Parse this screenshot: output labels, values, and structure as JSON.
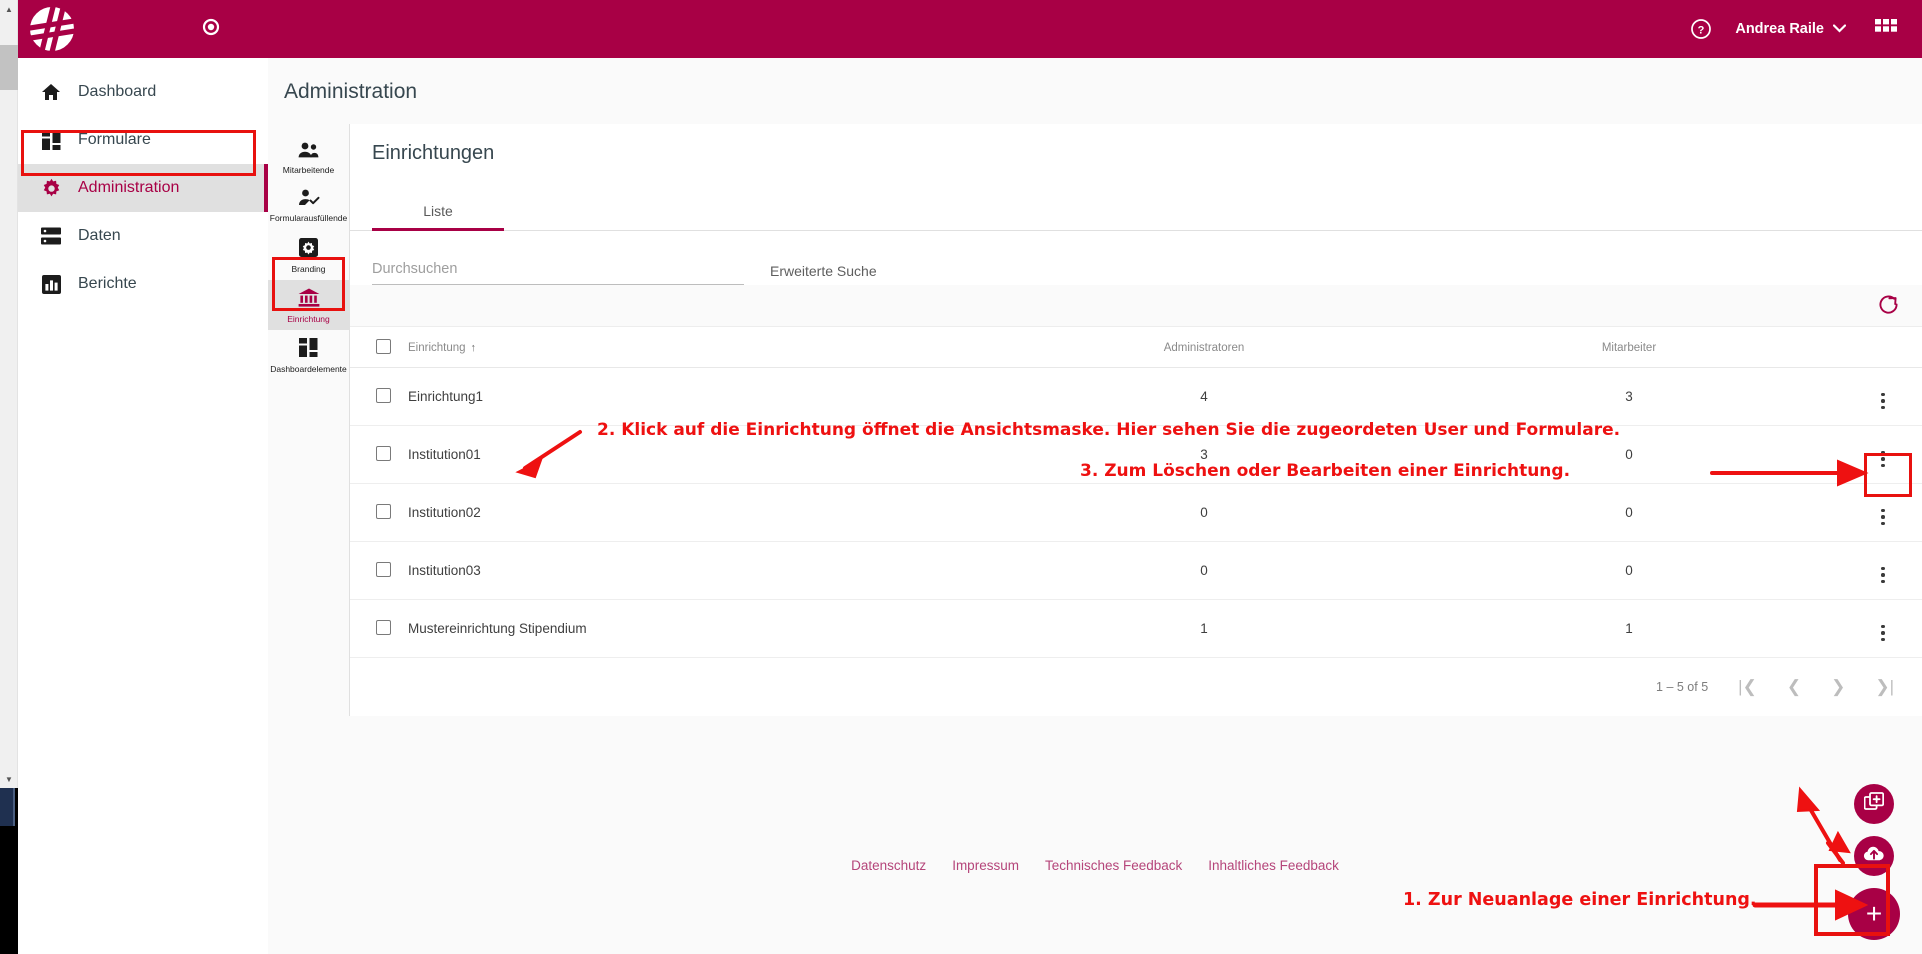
{
  "brand": {
    "primary": "#a80045",
    "annotation_red": "#ee1111"
  },
  "appbar": {
    "logo_icon": "hash-circle-logo",
    "record_icon": "record-dot-icon",
    "help_icon": "help-circle-icon",
    "user_name": "Andrea Raile",
    "user_chevron_icon": "chevron-down-icon",
    "apps_icon": "apps-grid-icon"
  },
  "sidebar": {
    "items": [
      {
        "label": "Dashboard",
        "icon": "home-icon",
        "active": false
      },
      {
        "label": "Formulare",
        "icon": "forms-icon",
        "active": false
      },
      {
        "label": "Administration",
        "icon": "gear-icon",
        "active": true
      },
      {
        "label": "Daten",
        "icon": "storage-icon",
        "active": false
      },
      {
        "label": "Berichte",
        "icon": "chart-bar-icon",
        "active": false
      }
    ]
  },
  "page": {
    "title": "Administration"
  },
  "icon_rail": {
    "items": [
      {
        "label": "Mitarbeitende",
        "icon": "people-icon",
        "active": false
      },
      {
        "label": "Formularausfüllende",
        "icon": "person-check-icon",
        "active": false
      },
      {
        "label": "Branding",
        "icon": "branding-gear-icon",
        "active": false
      },
      {
        "label": "Einrichtung",
        "icon": "institution-icon",
        "active": true
      },
      {
        "label": "Dashboardelemente",
        "icon": "dashboard-tiles-icon",
        "active": false
      }
    ]
  },
  "card": {
    "title": "Einrichtungen",
    "tabs": [
      {
        "label": "Liste",
        "active": true
      }
    ],
    "search": {
      "placeholder": "Durchsuchen",
      "value": ""
    },
    "advanced_search_label": "Erweiterte Suche",
    "refresh_icon": "refresh-icon"
  },
  "table": {
    "columns": [
      {
        "key": "name",
        "label": "Einrichtung",
        "sort": "asc",
        "sort_icon": "arrow-up-icon"
      },
      {
        "key": "admin",
        "label": "Administratoren"
      },
      {
        "key": "staff",
        "label": "Mitarbeiter"
      }
    ],
    "rows": [
      {
        "name": "Einrichtung1",
        "admin": "4",
        "staff": "3"
      },
      {
        "name": "Institution01",
        "admin": "3",
        "staff": "0"
      },
      {
        "name": "Institution02",
        "admin": "0",
        "staff": "0"
      },
      {
        "name": "Institution03",
        "admin": "0",
        "staff": "0"
      },
      {
        "name": "Mustereinrichtung Stipendium",
        "admin": "1",
        "staff": "1"
      }
    ],
    "row_menu_icon": "kebab-menu-icon"
  },
  "paginator": {
    "range_label": "1 – 5 of 5",
    "first_icon": "first-page-icon",
    "prev_icon": "previous-page-icon",
    "next_icon": "next-page-icon",
    "last_icon": "last-page-icon"
  },
  "footer": {
    "links": [
      "Datenschutz",
      "Impressum",
      "Technisches Feedback",
      "Inhaltliches Feedback"
    ]
  },
  "fabs": [
    {
      "name": "duplicate-add-fab",
      "icon": "copy-plus-icon"
    },
    {
      "name": "upload-fab",
      "icon": "cloud-upload-icon"
    },
    {
      "name": "create-fab",
      "icon": "plus-icon",
      "label": "+"
    }
  ],
  "annotations": [
    {
      "id": 2,
      "text": "2. Klick auf die Einrichtung öffnet die Ansichtsmaske. Hier sehen Sie die zugeordeten User und Formulare."
    },
    {
      "id": 3,
      "text": "3. Zum Löschen oder Bearbeiten einer Einrichtung."
    },
    {
      "id": 1,
      "text": "1. Zur Neuanlage einer Einrichtung."
    }
  ]
}
